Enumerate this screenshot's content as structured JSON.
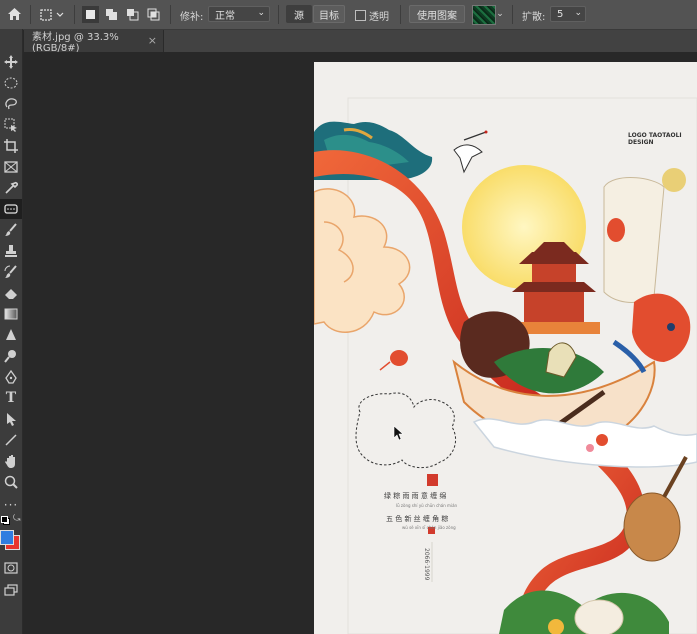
{
  "options_bar": {
    "home_icon": "home-icon",
    "patch_label": "修补:",
    "patch_mode": "正常",
    "source_label": "源",
    "target_label": "目标",
    "transparent_label": "透明",
    "use_pattern_label": "使用图案",
    "diffusion_label": "扩散:",
    "diffusion_value": "5"
  },
  "document_tab": {
    "title": "素材.jpg @ 33.3%(RGB/8#)",
    "close": "×"
  },
  "poster_text": {
    "logo": "LOGO TAOTAOLI DESIGN",
    "vertical_date": "2066·1999",
    "line1": "绿  粽  雨  雨  意  缠  绵",
    "line1_pinyin": "lǜ zòng shí yǔ chūn chán mián",
    "line2": "五  色  新  丝  缠  角  粽",
    "line2_pinyin": "wǔ sè xīn sī chán jiǎo zòng"
  },
  "colors": {
    "foreground": "#2f7de0",
    "background": "#e8352c",
    "ps_panel": "#535353"
  }
}
